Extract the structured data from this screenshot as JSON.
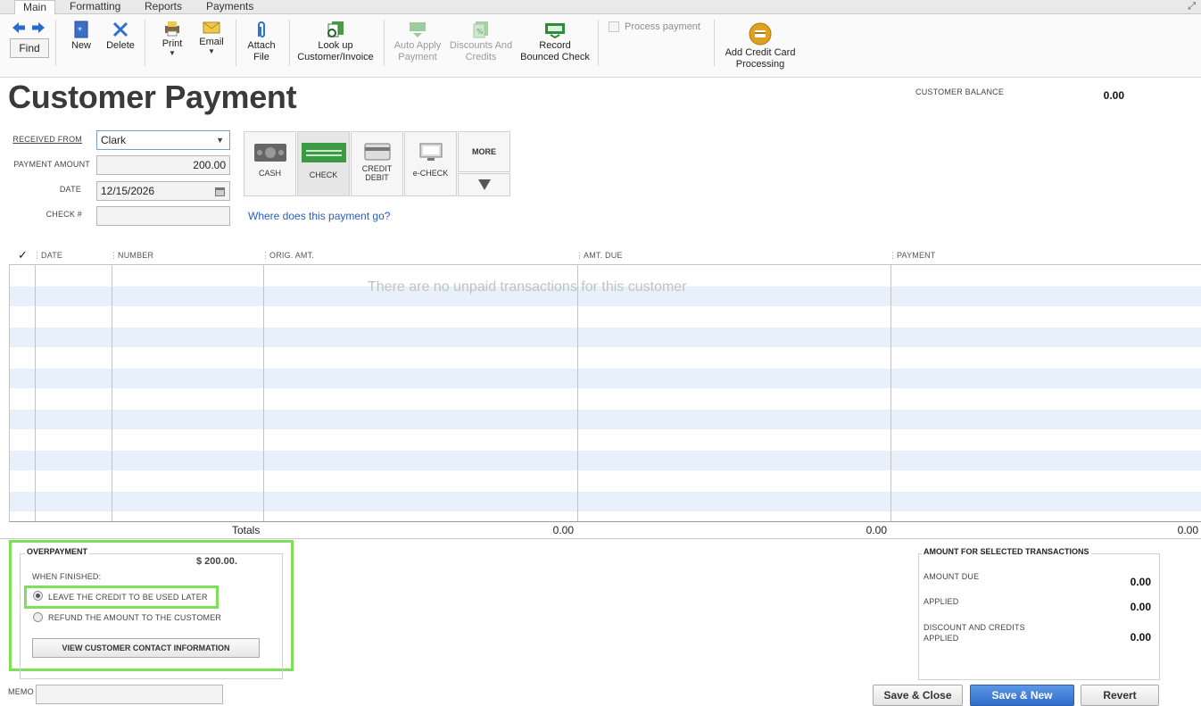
{
  "tabs": [
    {
      "label": "Main"
    },
    {
      "label": "Formatting"
    },
    {
      "label": "Reports"
    },
    {
      "label": "Payments"
    }
  ],
  "toolbar": {
    "find": "Find",
    "new": "New",
    "delete": "Delete",
    "print": "Print",
    "email": "Email",
    "attach_1": "Attach",
    "attach_2": "File",
    "lookup_1": "Look up",
    "lookup_2": "Customer/Invoice",
    "auto_1": "Auto Apply",
    "auto_2": "Payment",
    "disc_1": "Discounts And",
    "disc_2": "Credits",
    "record_1": "Record",
    "record_2": "Bounced Check",
    "process_payment": "Process payment",
    "addcc_1": "Add Credit Card",
    "addcc_2": "Processing"
  },
  "page_title": "Customer Payment",
  "customer_balance": {
    "label": "CUSTOMER BALANCE",
    "value": "0.00"
  },
  "form": {
    "received_from_label": "RECEIVED FROM",
    "received_from_value": "Clark",
    "payment_amount_label": "PAYMENT AMOUNT",
    "payment_amount_value": "200.00",
    "date_label": "DATE",
    "date_value": "12/15/2026",
    "check_label": "CHECK #",
    "check_value": "",
    "where_link": "Where does this payment go?"
  },
  "payment_methods": {
    "cash": "CASH",
    "check": "CHECK",
    "credit_1": "CREDIT",
    "credit_2": "DEBIT",
    "echeck": "e-CHECK",
    "more": "MORE"
  },
  "grid": {
    "headers": {
      "check": "✓",
      "date": "DATE",
      "number": "NUMBER",
      "orig": "ORIG. AMT.",
      "due": "AMT. DUE",
      "payment": "PAYMENT"
    },
    "empty_message": "There are no unpaid transactions for this customer",
    "totals_label": "Totals",
    "total_orig": "0.00",
    "total_due": "0.00",
    "total_payment": "0.00"
  },
  "overpayment": {
    "title": "OVERPAYMENT",
    "amount": "$ 200.00.",
    "when_finished": "WHEN FINISHED:",
    "option_leave": "LEAVE THE CREDIT TO BE USED LATER",
    "option_refund": "REFUND THE AMOUNT TO THE CUSTOMER",
    "view_contact": "VIEW CUSTOMER CONTACT INFORMATION"
  },
  "summary": {
    "title": "AMOUNT FOR SELECTED TRANSACTIONS",
    "amount_due_label": "AMOUNT DUE",
    "amount_due_value": "0.00",
    "applied_label": "APPLIED",
    "applied_value": "0.00",
    "discount_label_1": "DISCOUNT AND CREDITS",
    "discount_label_2": "APPLIED",
    "discount_value": "0.00"
  },
  "memo_label": "MEMO",
  "buttons": {
    "save_close": "Save & Close",
    "save_new": "Save & New",
    "revert": "Revert"
  },
  "colors": {
    "highlight": "#7ee05a",
    "primary_button": "#3d7cd6",
    "link": "#2a5cb8",
    "stripe": "#e8f0fb"
  }
}
